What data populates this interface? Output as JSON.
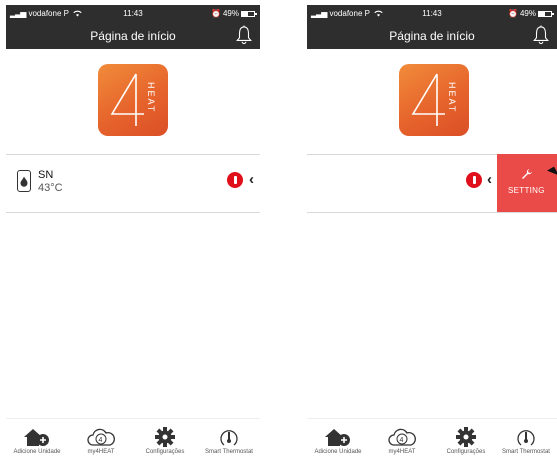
{
  "status_bar": {
    "carrier": "vodafone P",
    "time": "11:43",
    "battery": "49%",
    "battery_level": 0.49
  },
  "nav": {
    "title": "Página de início"
  },
  "unit": {
    "name": "SN",
    "temperature": "43°C"
  },
  "swipe_action": {
    "label": "SETTING"
  },
  "tabs": [
    {
      "label": "Adicione Unidade",
      "icon": "add-home-icon"
    },
    {
      "label": "my4HEAT",
      "icon": "cloud-4heat-icon"
    },
    {
      "label": "Configurações",
      "icon": "gear-icon"
    },
    {
      "label": "Smart Thermostat",
      "icon": "thermostat-icon"
    }
  ],
  "colors": {
    "header": "#2e2e2e",
    "logo_orange": "#e6642c",
    "alert_red": "#e0101b",
    "setting_red": "#ea4a48"
  }
}
